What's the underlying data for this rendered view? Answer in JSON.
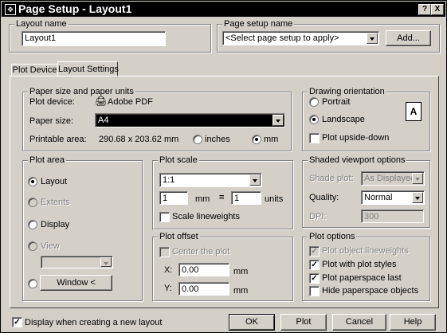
{
  "window": {
    "title": "Page Setup - Layout1",
    "icon": "app-icon",
    "help_label": "?",
    "close_label": "X"
  },
  "layout_name": {
    "label": "Layout name",
    "value": "Layout1"
  },
  "page_setup_name": {
    "label": "Page setup name",
    "selected": "<Select page setup to apply>",
    "add_label": "Add..."
  },
  "tabs": [
    {
      "label": "Plot Device",
      "active": false
    },
    {
      "label": "Layout Settings",
      "active": true
    }
  ],
  "paper": {
    "label": "Paper size and paper units",
    "plot_device_label": "Plot device:",
    "plot_device_value": "Adobe PDF",
    "paper_size_label": "Paper size:",
    "paper_size_value": "A4",
    "printable_area_label": "Printable area:",
    "printable_area_value": "290.68 x 203.62 mm",
    "units": [
      {
        "label": "inches",
        "checked": false
      },
      {
        "label": "mm",
        "checked": true
      }
    ]
  },
  "orientation": {
    "label": "Drawing orientation",
    "options": [
      {
        "label": "Portrait",
        "checked": false
      },
      {
        "label": "Landscape",
        "checked": true
      }
    ],
    "upside_down_label": "Plot upside-down",
    "upside_down_checked": false,
    "icon_glyph": "A"
  },
  "plot_area": {
    "label": "Plot area",
    "options": [
      {
        "label": "Layout",
        "checked": true,
        "enabled": true
      },
      {
        "label": "Extents",
        "checked": false,
        "enabled": false
      },
      {
        "label": "Display",
        "checked": false,
        "enabled": true
      },
      {
        "label": "View",
        "checked": false,
        "enabled": false
      }
    ],
    "view_select_value": "",
    "window_button_label": "Window <"
  },
  "plot_scale": {
    "label": "Plot scale",
    "scale_value": "1:1",
    "mm_value": "1",
    "mm_label": "mm",
    "equals": "=",
    "units_value": "1",
    "units_label": "units",
    "scale_lineweights_label": "Scale lineweights",
    "scale_lineweights_checked": false
  },
  "shaded": {
    "label": "Shaded viewport options",
    "shade_plot_label": "Shade plot:",
    "shade_plot_value": "As Displayed",
    "quality_label": "Quality:",
    "quality_value": "Normal",
    "dpi_label": "DPI:",
    "dpi_value": "300"
  },
  "plot_offset": {
    "label": "Plot offset",
    "center_label": "Center the plot",
    "center_checked": false,
    "x_label": "X:",
    "x_value": "0.00",
    "y_label": "Y:",
    "y_value": "0.00",
    "unit": "mm"
  },
  "plot_options": {
    "label": "Plot options",
    "items": [
      {
        "label": "Plot object lineweights",
        "checked": true,
        "enabled": false
      },
      {
        "label": "Plot with plot styles",
        "checked": true,
        "enabled": true
      },
      {
        "label": "Plot paperspace last",
        "checked": true,
        "enabled": true
      },
      {
        "label": "Hide paperspace objects",
        "checked": false,
        "enabled": true
      }
    ]
  },
  "footer": {
    "display_new_layout_label": "Display when creating a new layout",
    "display_new_layout_checked": true,
    "ok_label": "OK",
    "plot_label": "Plot",
    "cancel_label": "Cancel",
    "help_label": "Help"
  }
}
